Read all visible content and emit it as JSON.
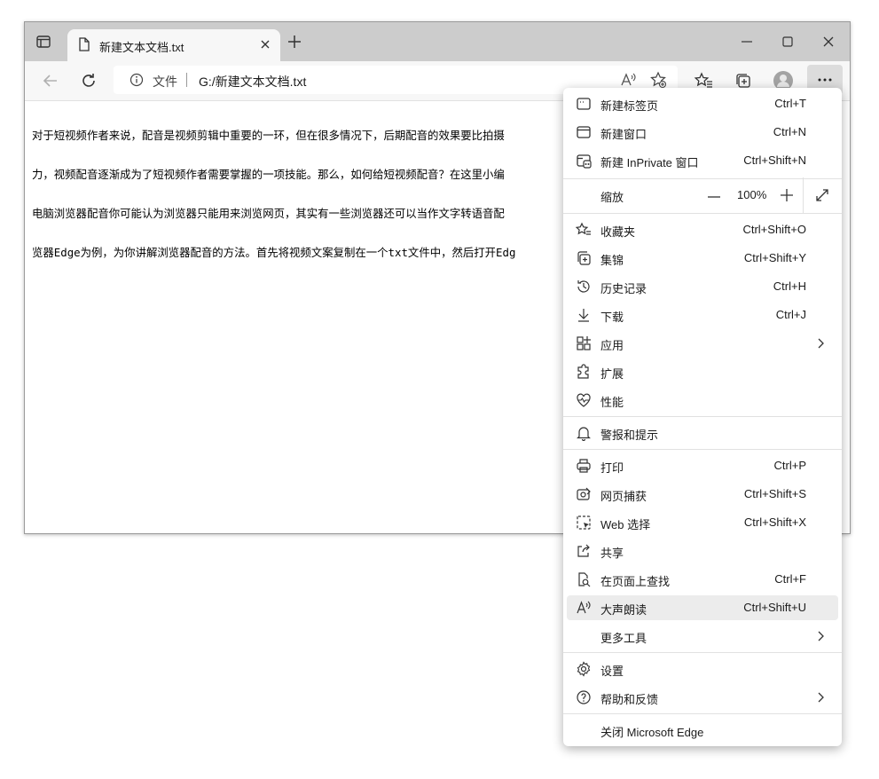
{
  "browser": {
    "tab_title": "新建文本文档.txt",
    "address_label": "文件",
    "address_url": "G:/新建文本文档.txt"
  },
  "document": {
    "lines": [
      "对于短视频作者来说，配音是视频剪辑中重要的一环，但在很多情况下，后期配音的效果要比拍摄",
      "力，视频配音逐渐成为了短视频作者需要掌握的一项技能。那么，如何给短视频配音？在这里小编",
      "电脑浏览器配音你可能认为浏览器只能用来浏览网页，其实有一些浏览器还可以当作文字转语音配",
      "览器Edge为例，为你讲解浏览器配音的方法。首先将视频文案复制在一个txt文件中，然后打开Edg"
    ]
  },
  "menu": {
    "items": [
      {
        "label": "新建标签页",
        "shortcut": "Ctrl+T",
        "icon": "new-tab-icon"
      },
      {
        "label": "新建窗口",
        "shortcut": "Ctrl+N",
        "icon": "new-window-icon"
      },
      {
        "label": "新建 InPrivate 窗口",
        "shortcut": "Ctrl+Shift+N",
        "icon": "inprivate-icon"
      },
      {
        "label": "缩放",
        "value": "100%"
      },
      {
        "label": "收藏夹",
        "shortcut": "Ctrl+Shift+O",
        "icon": "favorites-icon"
      },
      {
        "label": "集锦",
        "shortcut": "Ctrl+Shift+Y",
        "icon": "collections-icon"
      },
      {
        "label": "历史记录",
        "shortcut": "Ctrl+H",
        "icon": "history-icon"
      },
      {
        "label": "下载",
        "shortcut": "Ctrl+J",
        "icon": "download-icon"
      },
      {
        "label": "应用",
        "shortcut": "",
        "icon": "apps-icon"
      },
      {
        "label": "扩展",
        "shortcut": "",
        "icon": "extensions-icon"
      },
      {
        "label": "性能",
        "shortcut": "",
        "icon": "performance-icon"
      },
      {
        "label": "警报和提示",
        "shortcut": "",
        "icon": "bell-icon"
      },
      {
        "label": "打印",
        "shortcut": "Ctrl+P",
        "icon": "print-icon"
      },
      {
        "label": "网页捕获",
        "shortcut": "Ctrl+Shift+S",
        "icon": "web-capture-icon"
      },
      {
        "label": "Web 选择",
        "shortcut": "Ctrl+Shift+X",
        "icon": "web-select-icon"
      },
      {
        "label": "共享",
        "shortcut": "",
        "icon": "share-icon"
      },
      {
        "label": "在页面上查找",
        "shortcut": "Ctrl+F",
        "icon": "find-icon"
      },
      {
        "label": "大声朗读",
        "shortcut": "Ctrl+Shift+U",
        "icon": "read-aloud-icon"
      },
      {
        "label": "更多工具",
        "shortcut": ""
      },
      {
        "label": "设置",
        "shortcut": "",
        "icon": "gear-icon"
      },
      {
        "label": "帮助和反馈",
        "shortcut": "",
        "icon": "help-icon"
      },
      {
        "label": "关闭 Microsoft Edge",
        "shortcut": ""
      }
    ]
  }
}
